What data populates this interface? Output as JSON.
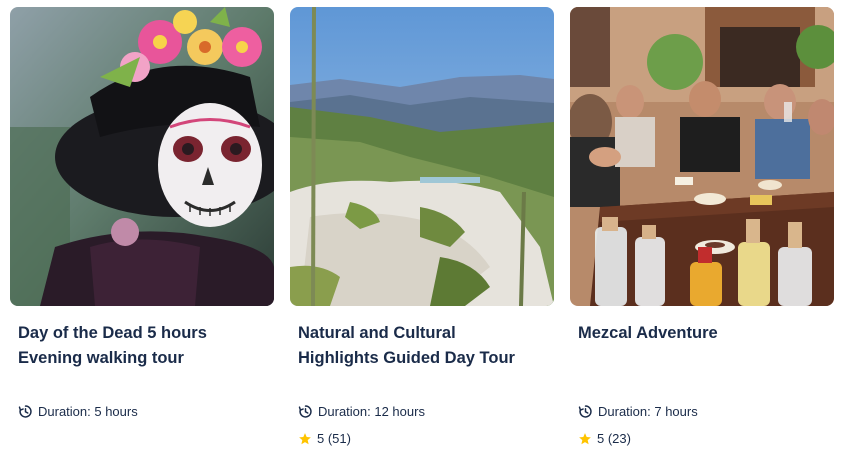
{
  "colors": {
    "text": "#1a2b49",
    "star": "#ffc400"
  },
  "cards": [
    {
      "title": "Day of the Dead 5 hours\nEvening walking tour",
      "duration": "Duration: 5 hours",
      "image_icon": "day-of-the-dead-photo"
    },
    {
      "title": "Natural and Cultural\nHighlights Guided Day Tour",
      "duration": "Duration: 12 hours",
      "rating": "5 (51)",
      "image_icon": "mountain-landscape-photo"
    },
    {
      "title": "Mezcal Adventure",
      "duration": "Duration: 7 hours",
      "rating": "5 (23)",
      "image_icon": "mezcal-tasting-photo"
    }
  ]
}
